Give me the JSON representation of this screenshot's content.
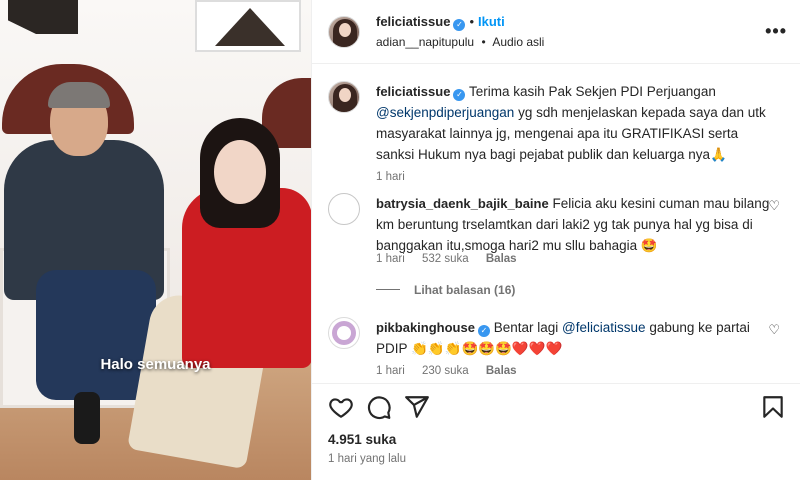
{
  "media": {
    "caption": "Halo semuanya"
  },
  "header": {
    "username": "feliciatissue",
    "follow_label": "Ikuti",
    "separator": "•",
    "audio_user": "adian__napitupulu",
    "audio_label": "Audio asli",
    "more_icon": "more-options-icon"
  },
  "caption_comment": {
    "username": "feliciatissue",
    "text_before": "Terima kasih Pak Sekjen PDI Perjuangan",
    "mention": "@sekjenpdiperjuangan",
    "text_after": "yg sdh menjelaskan kepada saya dan utk masyarakat lainnya jg, mengenai apa itu GRATIFIKASI serta sanksi Hukum nya bagi pejabat publik dan keluarga nya🙏",
    "time": "1 hari"
  },
  "comments": [
    {
      "username": "batrysia_daenk_bajik_baine",
      "text": "Felicia aku kesini cuman mau bilang km beruntung trselamtkan dari laki2 yg tak punya hal yg bisa di banggakan itu,smoga hari2 mu sllu bahagia 🤩",
      "time": "1 hari",
      "likes": "532 suka",
      "reply_label": "Balas",
      "view_replies": "Lihat balasan (16)"
    },
    {
      "username": "pikbakinghouse",
      "mention": "@feliciatissue",
      "text_before": "Bentar lagi",
      "text_after": "gabung ke partai PDIP 👏👏👏🤩🤩🤩❤️❤️❤️",
      "time": "1 hari",
      "likes": "230 suka",
      "reply_label": "Balas"
    }
  ],
  "actions": {
    "like_icon": "heart-icon",
    "comment_icon": "comment-icon",
    "share_icon": "share-icon",
    "save_icon": "bookmark-icon",
    "likes_count": "4.951 suka",
    "posted": "1 hari yang lalu"
  }
}
